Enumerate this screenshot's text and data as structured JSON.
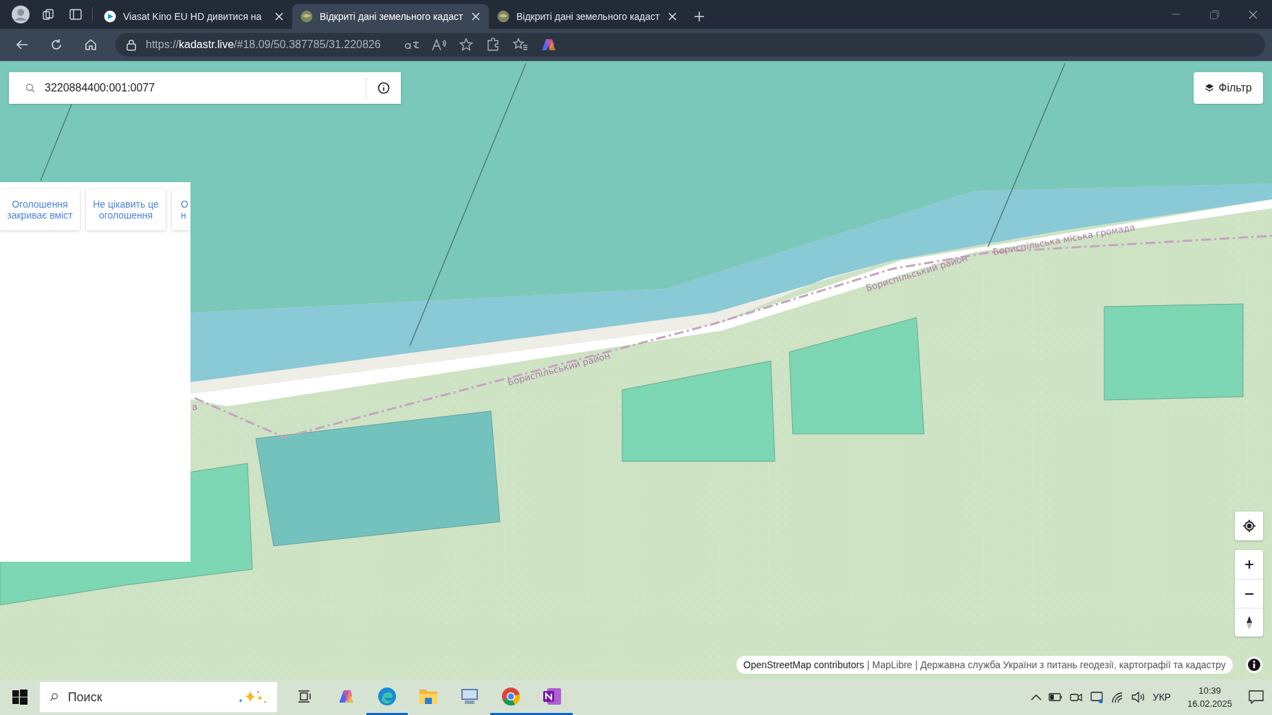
{
  "browser": {
    "tabs": [
      {
        "title": "Viasat Kino EU HD дивитися на",
        "kind": "video",
        "selected": false
      },
      {
        "title": "Відкриті дані земельного кадаст",
        "kind": "site",
        "selected": true
      },
      {
        "title": "Відкриті дані земельного кадаст",
        "kind": "site",
        "selected": false
      }
    ],
    "address": "https://**kadastr.live**/#18.09/50.387785/31.220826"
  },
  "search": {
    "value": "3220884400:001:0077"
  },
  "filter_button": "Фільтр",
  "ad_panel": {
    "buttons": [
      {
        "lines": [
          "Оголошення",
          "закриває вміст"
        ],
        "kind": "full"
      },
      {
        "lines": [
          "Не цікавить це",
          "оголошення"
        ],
        "kind": "full"
      },
      {
        "lines": [
          "О",
          "н"
        ],
        "kind": "cut"
      }
    ]
  },
  "map_labels": [
    "Бориспільський район",
    "Бориспільський район",
    "Бориспільська міська громада",
    "а"
  ],
  "attribution": {
    "parts": [
      "OpenStreetMap contributors",
      "MapLibre",
      "Державна служба України з питань геодезії, картографії та кадастру"
    ],
    "separator": "|"
  },
  "taskbar": {
    "search_placeholder": "Поиск",
    "apps": [
      {
        "kind": "copilot",
        "running": false
      },
      {
        "kind": "edge",
        "running": true
      },
      {
        "kind": "explorer",
        "running": false
      },
      {
        "kind": "computer",
        "running": false
      },
      {
        "kind": "chrome",
        "running": true
      },
      {
        "kind": "onenote",
        "running": true
      }
    ],
    "language": "УКР",
    "time": "10:39",
    "date": "16.02.2025"
  }
}
